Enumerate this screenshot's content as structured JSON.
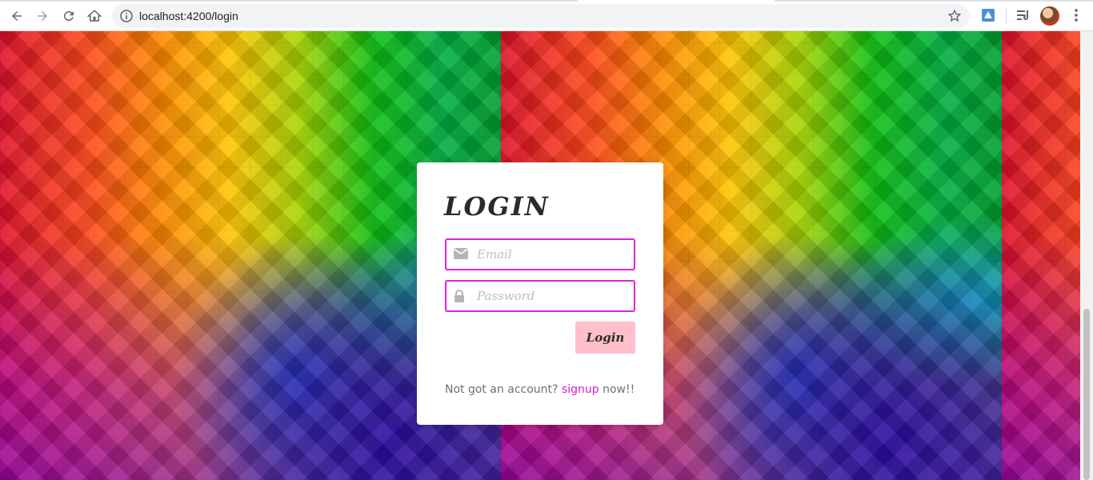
{
  "browser": {
    "url": "localhost:4200/login",
    "icons": {
      "back": "back-arrow-icon",
      "forward": "forward-arrow-icon",
      "reload": "reload-icon",
      "home": "home-icon",
      "info": "info-icon",
      "star": "bookmark-star-icon",
      "extension": "extension-icon",
      "playlist": "media-playlist-icon",
      "menu": "kebab-menu-icon"
    }
  },
  "login": {
    "title": "LOGIN",
    "email_placeholder": "Email",
    "password_placeholder": "Password",
    "login_button": "Login",
    "signup_prefix": "Not got an account?",
    "signup_link": "signup",
    "signup_suffix": "now!!"
  },
  "colors": {
    "field_border": "#dd22dd",
    "button_bg": "#ffc0cb",
    "link": "#d21fcf"
  }
}
